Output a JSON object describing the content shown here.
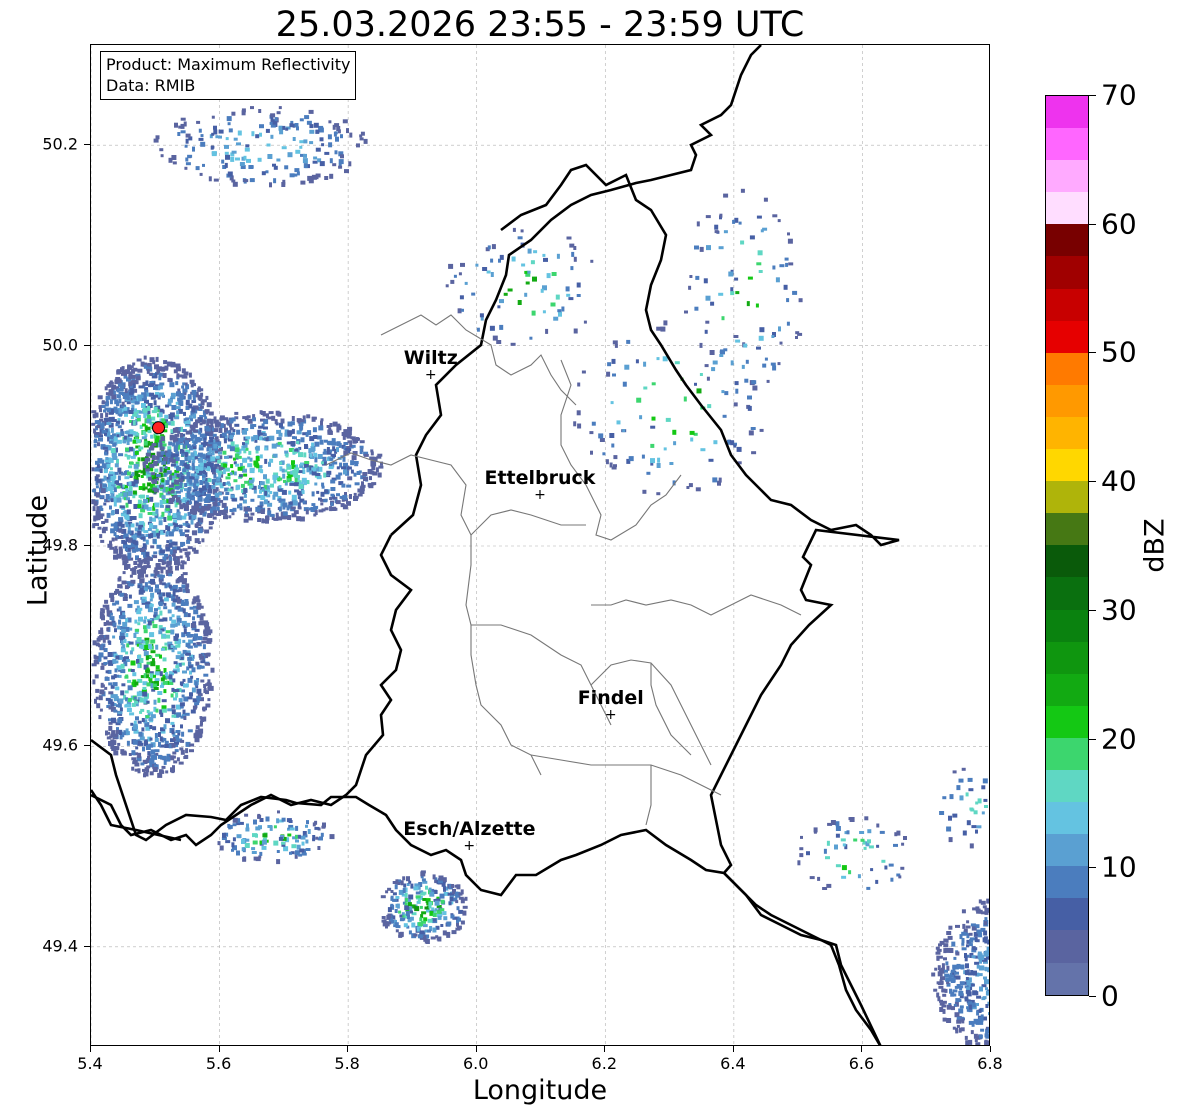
{
  "title": "25.03.2026 23:55 - 23:59 UTC",
  "info": {
    "product": "Product: Maximum Reflectivity",
    "data_source": "Data: RMIB"
  },
  "axes": {
    "xlabel": "Longitude",
    "ylabel": "Latitude",
    "x_ticks": [
      "5.4",
      "5.6",
      "5.8",
      "6.0",
      "6.2",
      "6.4",
      "6.6",
      "6.8"
    ],
    "y_ticks": [
      "50.2",
      "50.0",
      "49.8",
      "49.6",
      "49.4"
    ],
    "xlim": [
      5.4,
      6.8
    ],
    "ylim": [
      49.3,
      50.3
    ],
    "grid": true
  },
  "colorbar": {
    "label": "dBZ",
    "ticks": [
      "70",
      "60",
      "50",
      "40",
      "30",
      "20",
      "10",
      "0"
    ],
    "range": [
      0,
      70
    ],
    "colors": [
      "#ee33ee",
      "#ff66ff",
      "#ffaaff",
      "#ffddff",
      "#780000",
      "#a00000",
      "#c80000",
      "#e60000",
      "#ff7a00",
      "#ff9900",
      "#ffb400",
      "#ffd700",
      "#afb40a",
      "#467814",
      "#0a5a0a",
      "#0a700f",
      "#0a820f",
      "#0f960f",
      "#12aa12",
      "#14c814",
      "#3cd66e",
      "#5fd7c3",
      "#64c3e1",
      "#5aa0d2",
      "#4b7dbe",
      "#465fa5",
      "#5a64a0",
      "#6473aa"
    ]
  },
  "cities": [
    {
      "name": "Wiltz",
      "lon": 5.93,
      "lat": 49.97
    },
    {
      "name": "Ettelbruck",
      "lon": 6.1,
      "lat": 49.85
    },
    {
      "name": "Findel",
      "lon": 6.21,
      "lat": 49.63
    },
    {
      "name": "Esch/Alzette",
      "lon": 5.99,
      "lat": 49.5
    }
  ],
  "marker": {
    "lon": 5.505,
    "lat": 49.918,
    "color": "#ff2222"
  }
}
